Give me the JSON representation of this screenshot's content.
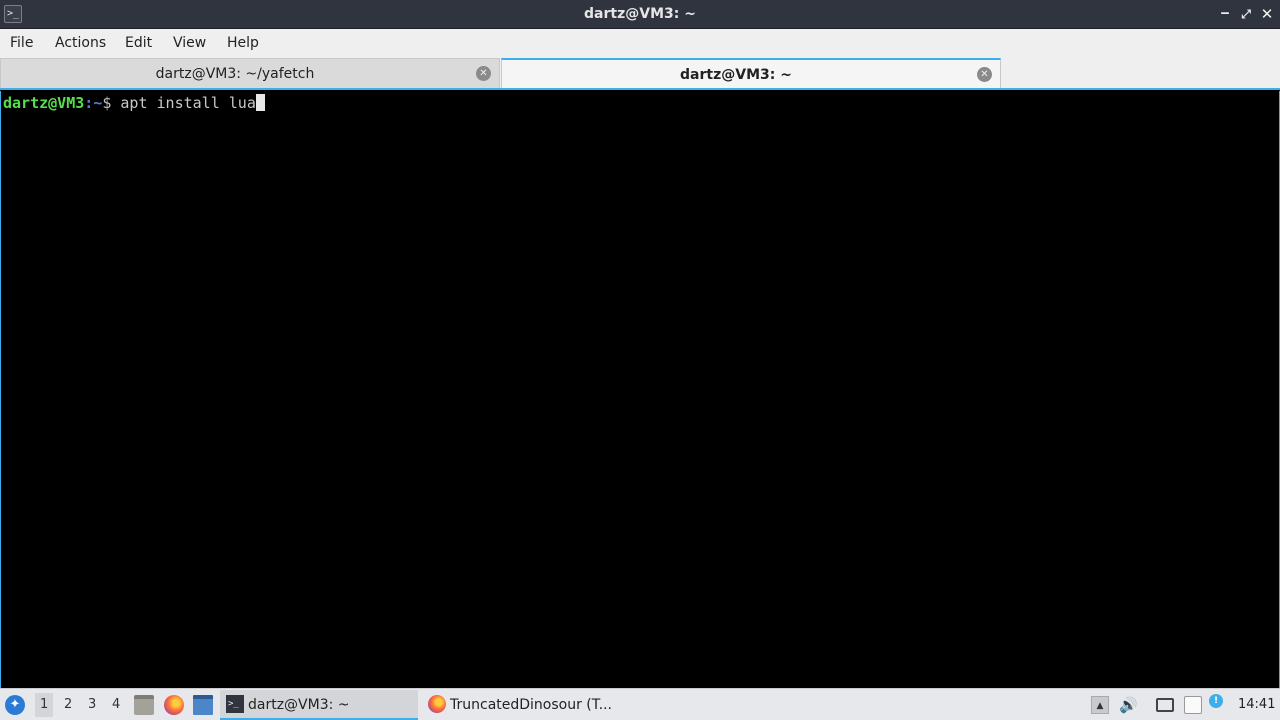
{
  "window": {
    "title": "dartz@VM3: ~",
    "app_icon": ">_",
    "controls": {
      "minimize": "‒",
      "maximize": "⤢",
      "close": "✕"
    }
  },
  "menubar": {
    "items": [
      "File",
      "Actions",
      "Edit",
      "View",
      "Help"
    ]
  },
  "tabs": [
    {
      "label": "dartz@VM3: ~/yafetch",
      "active": false
    },
    {
      "label": "dartz@VM3: ~",
      "active": true
    }
  ],
  "terminal": {
    "prompt_user": "dartz@VM3",
    "prompt_path": ":~",
    "prompt_sign": "$ ",
    "command": "apt install lua"
  },
  "taskbar": {
    "desktops": [
      "1",
      "2",
      "3",
      "4"
    ],
    "current_desktop": "1",
    "launchers": [
      "files-icon",
      "firefox-icon",
      "window-icon"
    ],
    "tasks": [
      {
        "label": "dartz@VM3: ~",
        "icon": "terminal-icon",
        "active": true
      },
      {
        "label": "TruncatedDinosour (T...",
        "icon": "firefox-icon",
        "active": false
      }
    ],
    "tray": [
      "up-arrow-icon",
      "volume-icon",
      "monitor-icon",
      "clipboard-icon",
      "update-icon"
    ],
    "clock": "14:41"
  },
  "colors": {
    "accent": "#3daee9",
    "prompt_user": "#54e04a",
    "prompt_path": "#5b7ad8",
    "titlebar": "#2f343f",
    "terminal_bg": "#000000"
  }
}
